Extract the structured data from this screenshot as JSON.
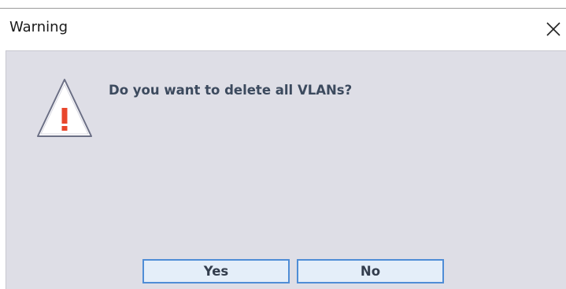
{
  "window": {
    "title": "Warning",
    "close_icon": "close-icon"
  },
  "dialog": {
    "icon": "warning-icon",
    "message": "Do you want to delete all VLANs?",
    "buttons": {
      "yes_label": "Yes",
      "no_label": "No"
    }
  },
  "colors": {
    "client_background": "#dedee6",
    "message_text": "#3c4a5e",
    "button_border": "#4f8dd6",
    "button_fill": "#e4eef9",
    "warning_mark": "#e8462c"
  }
}
